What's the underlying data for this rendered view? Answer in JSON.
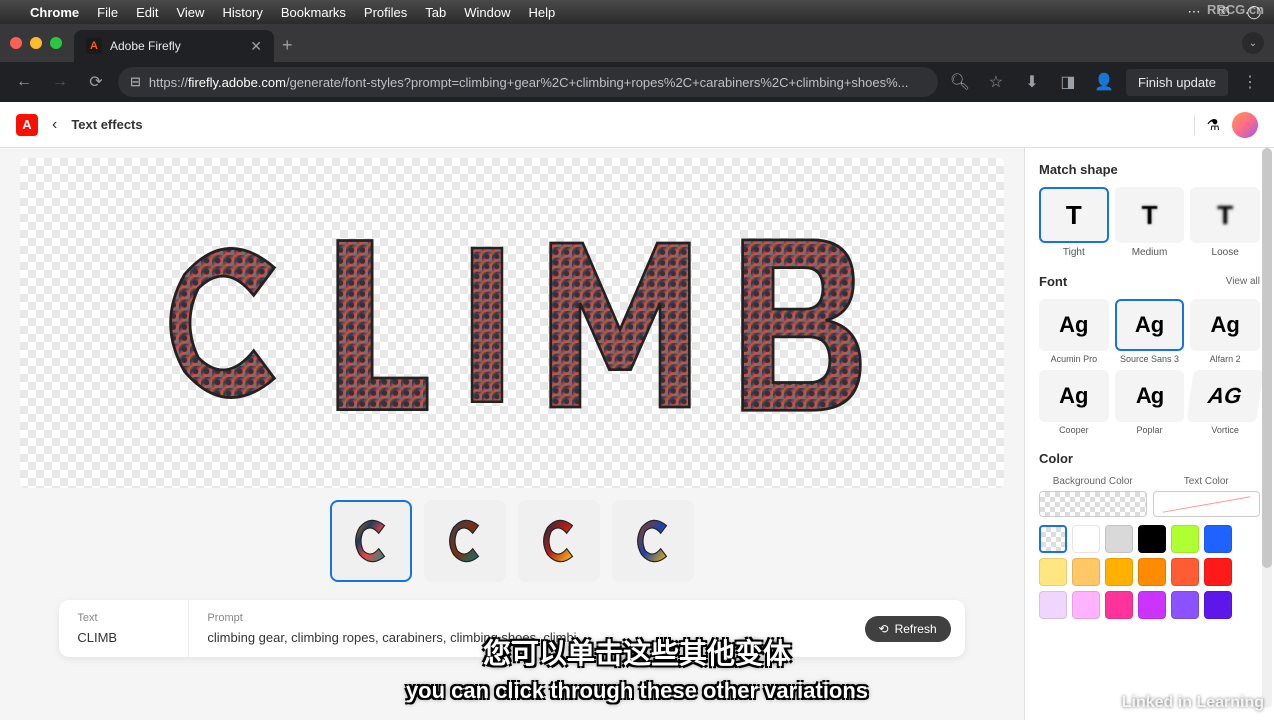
{
  "mac_menu": {
    "app_name": "Chrome",
    "items": [
      "File",
      "Edit",
      "View",
      "History",
      "Bookmarks",
      "Profiles",
      "Tab",
      "Window",
      "Help"
    ]
  },
  "chrome": {
    "tab_title": "Adobe Firefly",
    "tab_favicon": "A",
    "url_prefix": "https://",
    "url_domain": "firefly.adobe.com",
    "url_path": "/generate/font-styles?prompt=climbing+gear%2C+climbing+ropes%2C+carabiners%2C+climbing+shoes%...",
    "finish_update": "Finish update"
  },
  "app_header": {
    "adobe_badge": "A",
    "title": "Text effects"
  },
  "canvas": {
    "preview_letters": [
      "C",
      "L",
      "I",
      "M",
      "B"
    ],
    "variation_count": 4,
    "text_label": "Text",
    "text_value": "CLIMB",
    "prompt_label": "Prompt",
    "prompt_value": "climbing gear, climbing ropes, carabiners, climbing shoes, climbi",
    "refresh_label": "Refresh"
  },
  "panel": {
    "match_shape": {
      "title": "Match shape",
      "options": [
        {
          "glyph": "T",
          "label": "Tight"
        },
        {
          "glyph": "T",
          "label": "Medium"
        },
        {
          "glyph": "T",
          "label": "Loose"
        }
      ]
    },
    "font": {
      "title": "Font",
      "view_all": "View all",
      "options": [
        {
          "glyph": "Ag",
          "label": "Acumin Pro"
        },
        {
          "glyph": "Ag",
          "label": "Source Sans 3"
        },
        {
          "glyph": "Ag",
          "label": "Alfarn 2"
        },
        {
          "glyph": "Ag",
          "label": "Cooper"
        },
        {
          "glyph": "Ag",
          "label": "Poplar"
        },
        {
          "glyph": "AG",
          "label": "Vortice"
        }
      ]
    },
    "color": {
      "title": "Color",
      "bg_label": "Background Color",
      "text_label": "Text Color",
      "swatches": [
        "transparent",
        "#ffffff",
        "#d9d9d9",
        "#000000",
        "#b0ff33",
        "#1e62ff",
        "#ffe680",
        "#ffc766",
        "#ffb000",
        "#ff8c00",
        "#ff5c33",
        "#ff1a1a",
        "#f0d6ff",
        "#ffb3ff",
        "#ff3399",
        "#cc33ff",
        "#8c52ff",
        "#5e17eb"
      ]
    }
  },
  "overlays": {
    "caption_cn": "您可以单击这些其他变体",
    "caption_en": "you can click through these other variations",
    "watermark_br": "Linked in Learning",
    "watermark_tr": "RRCG.cn"
  }
}
